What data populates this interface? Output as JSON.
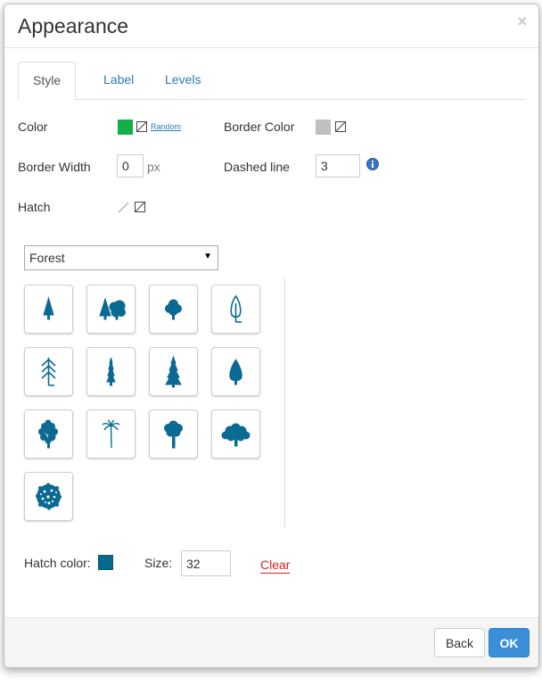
{
  "dialog": {
    "title": "Appearance",
    "close_label": "×"
  },
  "tabs": [
    {
      "label": "Style",
      "active": true
    },
    {
      "label": "Label",
      "active": false
    },
    {
      "label": "Levels",
      "active": false
    }
  ],
  "style": {
    "color_label": "Color",
    "color_value": "#13b04a",
    "random_label": "Random",
    "border_color_label": "Border Color",
    "border_color_value": "#bfbfbf",
    "border_width_label": "Border Width",
    "border_width_value": "0",
    "border_width_unit": "px",
    "dashed_line_label": "Dashed line",
    "dashed_line_value": "3",
    "hatch_label": "Hatch"
  },
  "hatch": {
    "category_selected": "Forest",
    "patterns": [
      {
        "icon": "small-conifer-icon"
      },
      {
        "icon": "tree-group-icon"
      },
      {
        "icon": "round-tree-icon"
      },
      {
        "icon": "outline-tree-icon"
      },
      {
        "icon": "outline-pine-icon"
      },
      {
        "icon": "narrow-fir-icon"
      },
      {
        "icon": "spruce-icon"
      },
      {
        "icon": "teardrop-tree-icon"
      },
      {
        "icon": "bushy-tree-icon"
      },
      {
        "icon": "palm-tree-icon"
      },
      {
        "icon": "oak-tree-icon"
      },
      {
        "icon": "broad-crown-tree-icon"
      },
      {
        "icon": "shrub-top-view-icon"
      }
    ],
    "hatch_color_label": "Hatch color:",
    "hatch_color_value": "#05698f",
    "size_label": "Size:",
    "size_value": "32",
    "clear_label": "Clear"
  },
  "footer": {
    "back_label": "Back",
    "ok_label": "OK"
  }
}
